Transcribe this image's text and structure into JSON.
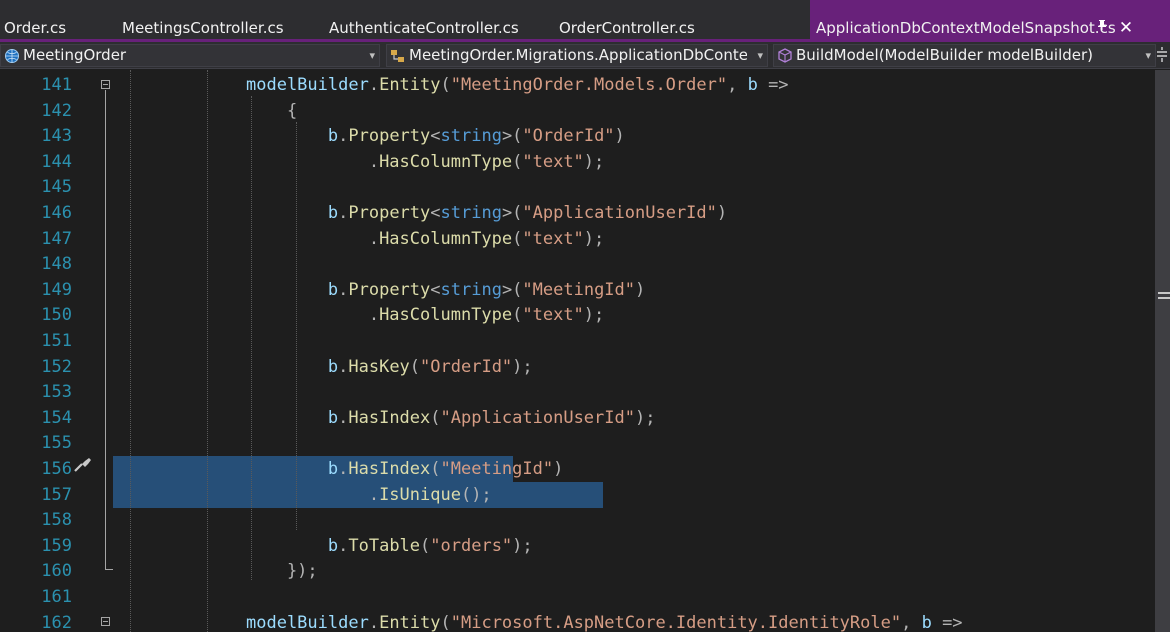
{
  "tabs": [
    {
      "label": "Order.cs",
      "active": false
    },
    {
      "label": "MeetingsController.cs",
      "active": false
    },
    {
      "label": "AuthenticateController.cs",
      "active": false
    },
    {
      "label": "OrderController.cs",
      "active": false
    },
    {
      "label": "ApplicationDbContextModelSnapshot.cs",
      "active": true
    }
  ],
  "navbar": {
    "project": "MeetingOrder",
    "class_path": "MeetingOrder.Migrations.ApplicationDbContextMc",
    "member": "BuildModel(ModelBuilder modelBuilder)"
  },
  "colors": {
    "accent": "#68217a",
    "selection": "#264f78",
    "line_number": "#2b91af",
    "method": "#dcdcaa",
    "keyword": "#569cd6",
    "string": "#d69d85",
    "identifier": "#9cdcfe"
  },
  "icons": {
    "pin": "pin-icon",
    "close": "close-icon",
    "project": "globe-project-icon",
    "class": "class-icon",
    "method": "method-cube-icon",
    "quick_action": "screwdriver-icon"
  },
  "editor": {
    "lines": [
      {
        "num": "141",
        "tokens": [
          {
            "t": "modelBuilder",
            "c": "ident"
          },
          {
            "t": ".",
            "c": "punct"
          },
          {
            "t": "Entity",
            "c": "method"
          },
          {
            "t": "(",
            "c": "punct"
          },
          {
            "t": "\"MeetingOrder.Models.Order\"",
            "c": "str"
          },
          {
            "t": ", ",
            "c": "punct"
          },
          {
            "t": "b",
            "c": "ident"
          },
          {
            "t": " =>",
            "c": "punct"
          }
        ]
      },
      {
        "num": "142",
        "tokens": [
          {
            "t": "    {",
            "c": "punct"
          }
        ]
      },
      {
        "num": "143",
        "tokens": [
          {
            "t": "        b",
            "c": "ident"
          },
          {
            "t": ".",
            "c": "punct"
          },
          {
            "t": "Property",
            "c": "method"
          },
          {
            "t": "<",
            "c": "punct"
          },
          {
            "t": "string",
            "c": "type"
          },
          {
            "t": ">(",
            "c": "punct"
          },
          {
            "t": "\"OrderId\"",
            "c": "str"
          },
          {
            "t": ")",
            "c": "punct"
          }
        ]
      },
      {
        "num": "144",
        "tokens": [
          {
            "t": "            .",
            "c": "punct"
          },
          {
            "t": "HasColumnType",
            "c": "method"
          },
          {
            "t": "(",
            "c": "punct"
          },
          {
            "t": "\"text\"",
            "c": "str"
          },
          {
            "t": ");",
            "c": "punct"
          }
        ]
      },
      {
        "num": "145",
        "tokens": []
      },
      {
        "num": "146",
        "tokens": [
          {
            "t": "        b",
            "c": "ident"
          },
          {
            "t": ".",
            "c": "punct"
          },
          {
            "t": "Property",
            "c": "method"
          },
          {
            "t": "<",
            "c": "punct"
          },
          {
            "t": "string",
            "c": "type"
          },
          {
            "t": ">(",
            "c": "punct"
          },
          {
            "t": "\"ApplicationUserId\"",
            "c": "str"
          },
          {
            "t": ")",
            "c": "punct"
          }
        ]
      },
      {
        "num": "147",
        "tokens": [
          {
            "t": "            .",
            "c": "punct"
          },
          {
            "t": "HasColumnType",
            "c": "method"
          },
          {
            "t": "(",
            "c": "punct"
          },
          {
            "t": "\"text\"",
            "c": "str"
          },
          {
            "t": ");",
            "c": "punct"
          }
        ]
      },
      {
        "num": "148",
        "tokens": []
      },
      {
        "num": "149",
        "tokens": [
          {
            "t": "        b",
            "c": "ident"
          },
          {
            "t": ".",
            "c": "punct"
          },
          {
            "t": "Property",
            "c": "method"
          },
          {
            "t": "<",
            "c": "punct"
          },
          {
            "t": "string",
            "c": "type"
          },
          {
            "t": ">(",
            "c": "punct"
          },
          {
            "t": "\"MeetingId\"",
            "c": "str"
          },
          {
            "t": ")",
            "c": "punct"
          }
        ]
      },
      {
        "num": "150",
        "tokens": [
          {
            "t": "            .",
            "c": "punct"
          },
          {
            "t": "HasColumnType",
            "c": "method"
          },
          {
            "t": "(",
            "c": "punct"
          },
          {
            "t": "\"text\"",
            "c": "str"
          },
          {
            "t": ");",
            "c": "punct"
          }
        ]
      },
      {
        "num": "151",
        "tokens": []
      },
      {
        "num": "152",
        "tokens": [
          {
            "t": "        b",
            "c": "ident"
          },
          {
            "t": ".",
            "c": "punct"
          },
          {
            "t": "HasKey",
            "c": "method"
          },
          {
            "t": "(",
            "c": "punct"
          },
          {
            "t": "\"OrderId\"",
            "c": "str"
          },
          {
            "t": ");",
            "c": "punct"
          }
        ]
      },
      {
        "num": "153",
        "tokens": []
      },
      {
        "num": "154",
        "tokens": [
          {
            "t": "        b",
            "c": "ident"
          },
          {
            "t": ".",
            "c": "punct"
          },
          {
            "t": "HasIndex",
            "c": "method"
          },
          {
            "t": "(",
            "c": "punct"
          },
          {
            "t": "\"ApplicationUserId\"",
            "c": "str"
          },
          {
            "t": ");",
            "c": "punct"
          }
        ]
      },
      {
        "num": "155",
        "tokens": []
      },
      {
        "num": "156",
        "selected": true,
        "tokens": [
          {
            "t": "        b",
            "c": "ident"
          },
          {
            "t": ".",
            "c": "punct"
          },
          {
            "t": "HasIndex",
            "c": "method"
          },
          {
            "t": "(",
            "c": "punct"
          },
          {
            "t": "\"MeetingId\"",
            "c": "str"
          },
          {
            "t": ")",
            "c": "punct"
          }
        ]
      },
      {
        "num": "157",
        "selected": true,
        "tokens": [
          {
            "t": "            .",
            "c": "punct"
          },
          {
            "t": "IsUnique",
            "c": "method"
          },
          {
            "t": "();",
            "c": "punct"
          }
        ]
      },
      {
        "num": "158",
        "tokens": []
      },
      {
        "num": "159",
        "tokens": [
          {
            "t": "        b",
            "c": "ident"
          },
          {
            "t": ".",
            "c": "punct"
          },
          {
            "t": "ToTable",
            "c": "method"
          },
          {
            "t": "(",
            "c": "punct"
          },
          {
            "t": "\"orders\"",
            "c": "str"
          },
          {
            "t": ");",
            "c": "punct"
          }
        ]
      },
      {
        "num": "160",
        "tokens": [
          {
            "t": "    });",
            "c": "punct"
          }
        ]
      },
      {
        "num": "161",
        "tokens": []
      },
      {
        "num": "162",
        "tokens": [
          {
            "t": "modelBuilder",
            "c": "ident"
          },
          {
            "t": ".",
            "c": "punct"
          },
          {
            "t": "Entity",
            "c": "method"
          },
          {
            "t": "(",
            "c": "punct"
          },
          {
            "t": "\"Microsoft.AspNetCore.Identity.IdentityRole\"",
            "c": "str"
          },
          {
            "t": ", ",
            "c": "punct"
          },
          {
            "t": "b",
            "c": "ident"
          },
          {
            "t": " =>",
            "c": "punct"
          }
        ]
      }
    ]
  }
}
